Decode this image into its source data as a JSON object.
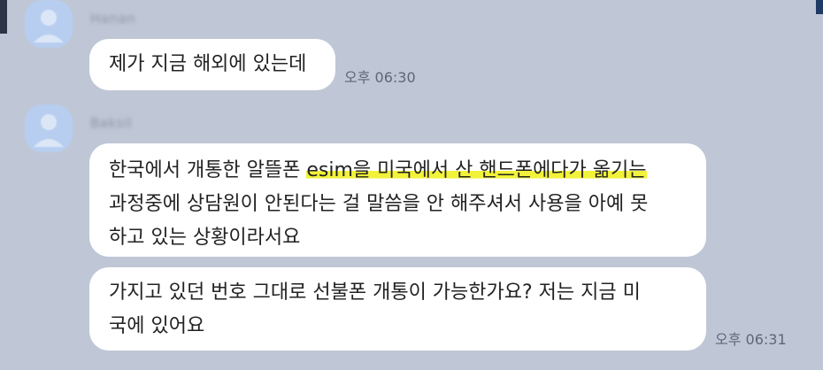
{
  "chat": {
    "groups": [
      {
        "sender": "Hanan",
        "messages": [
          {
            "lines": [
              "제가 지금 해외에 있는데"
            ],
            "time": "오후 06:30"
          }
        ]
      },
      {
        "sender": "Baksil",
        "messages": [
          {
            "lines": [
              "한국에서 개통한 알뜰폰 ",
              "esim을 미국에서 산 핸드폰에다가 옮기는",
              "과정중에 상담원이 안된다는 걸 말씀을 안 해주셔서 사용을 아예 못",
              "하고 있는 상황이라서요"
            ],
            "time": ""
          },
          {
            "lines": [
              "가지고 있던 번호 그대로 선불폰 개통이 가능한가요? 저는 지금 미",
              "국에 있어요"
            ],
            "time": "오후 06:31"
          }
        ]
      }
    ]
  },
  "colors": {
    "background": "#bfc7d6",
    "bubble": "#ffffff",
    "highlight": "#f2f23a",
    "avatar": "#b8cef0"
  }
}
